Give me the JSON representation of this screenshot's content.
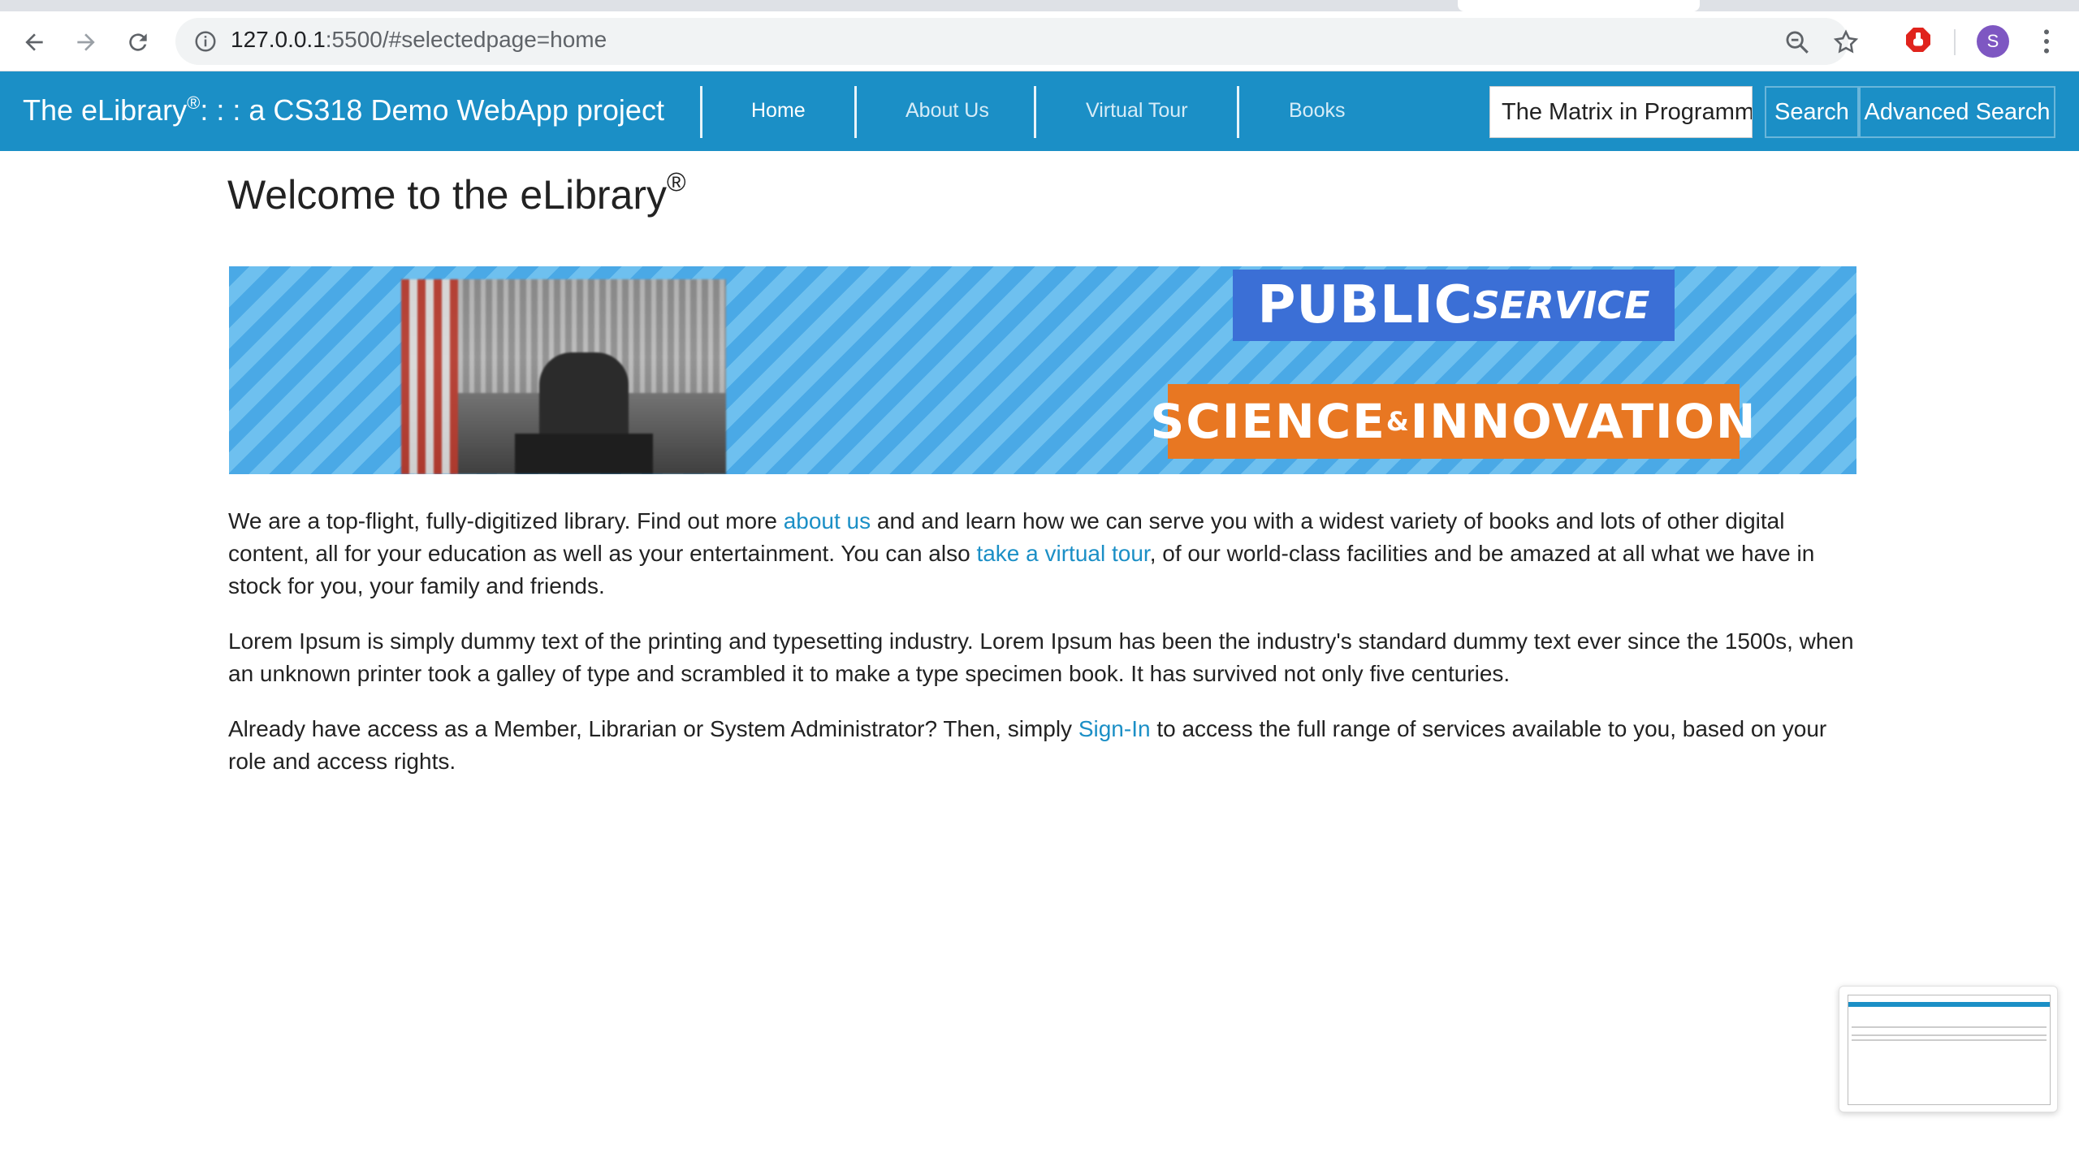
{
  "browser": {
    "url_host": "127.0.0.1",
    "url_rest": ":5500/#selectedpage=home",
    "avatar_letter": "S"
  },
  "navbar": {
    "brand_prefix": "The eLibrary",
    "brand_reg": "®",
    "brand_suffix": ": : : a CS318 Demo WebApp project",
    "links": [
      "Home",
      "About Us",
      "Virtual Tour",
      "Books"
    ],
    "search_value": "The Matrix in Programming",
    "search_button": "Search",
    "advanced_button": "Advanced Search"
  },
  "main": {
    "title": "Welcome to the eLibrary",
    "title_reg": "®",
    "banner": {
      "public": "PUBLIC",
      "service": "SERVICE",
      "science": "SCIENCE",
      "amp": "&",
      "innovation": "INNOVATION"
    },
    "p1": {
      "t1": "We are a top-flight, fully-digitized library. Find out more ",
      "link1": "about us",
      "t2": " and and learn how we can serve you with a widest variety of books and lots of other digital content, all for your education as well as your entertainment. You can also ",
      "link2": "take a virtual tour",
      "t3": ", of our world-class facilities and be amazed at all what we have in stock for you, your family and friends."
    },
    "p2": "Lorem Ipsum is simply dummy text of the printing and typesetting industry. Lorem Ipsum has been the industry's standard dummy text ever since the 1500s, when an unknown printer took a galley of type and scrambled it to make a type specimen book. It has survived not only five centuries.",
    "p3": {
      "t1": "Already have access as a Member, Librarian or System Administrator? Then, simply ",
      "link": "Sign-In",
      "t2": " to access the full range of services available to you, based on your role and access rights."
    }
  },
  "colors": {
    "navbar": "#1b8fc6",
    "link": "#1b8fc6",
    "banner_orange": "#e87722",
    "banner_blue": "#3b6fd6"
  }
}
